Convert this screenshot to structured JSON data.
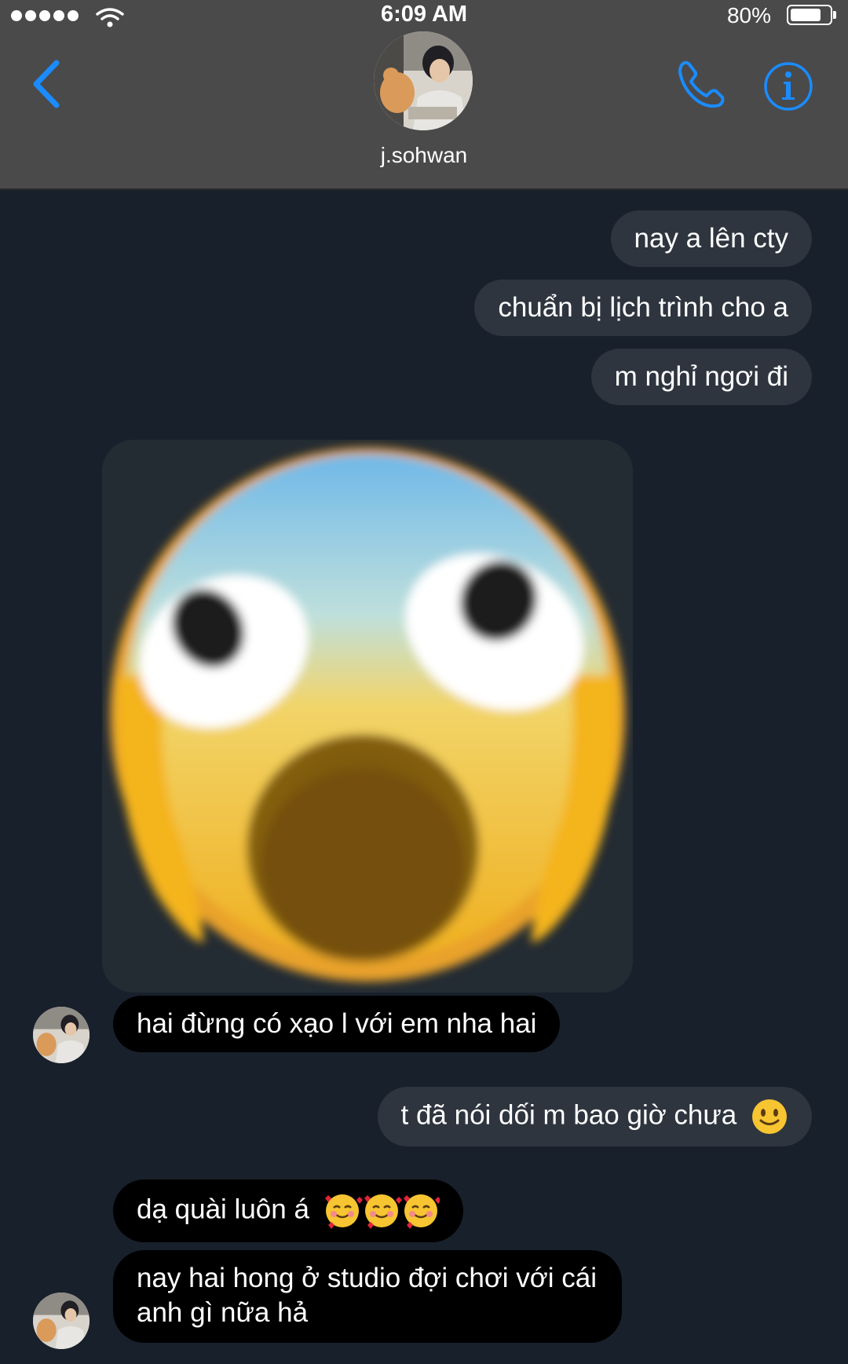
{
  "status_bar": {
    "time": "6:09 AM",
    "battery_percent": "80%",
    "battery_level": 0.8,
    "signal_bars": 5
  },
  "header": {
    "contact_name": "j.sohwan",
    "back_icon": "chevron-left-icon",
    "call_icon": "phone-icon",
    "info_icon": "info-icon",
    "accent_color": "#1a8cff"
  },
  "messages": [
    {
      "direction": "out",
      "text": "nay a lên cty"
    },
    {
      "direction": "out",
      "text": "chuẩn bị lịch trình cho a"
    },
    {
      "direction": "out",
      "text": "m nghỉ ngơi đi"
    },
    {
      "direction": "in",
      "type": "sticker",
      "sticker": "screaming-face-emoji"
    },
    {
      "direction": "in",
      "text": "hai đừng có xạo l với em nha hai"
    },
    {
      "direction": "out",
      "text": "t đã nói dối m bao giờ chưa",
      "emoji": "slightly-smiling-face"
    },
    {
      "direction": "in",
      "text": "dạ quài luôn á",
      "emoji": "smiling-face-with-hearts x3"
    },
    {
      "direction": "in",
      "text_line1": "nay hai hong ở studio đợi chơi với cái",
      "text_line2": "anh gì nữa hả"
    }
  ],
  "colors": {
    "header_bg": "#4a4a4b",
    "chat_bg": "#18202b",
    "outgoing_bubble": "#2e353f",
    "incoming_bubble": "#000000"
  }
}
